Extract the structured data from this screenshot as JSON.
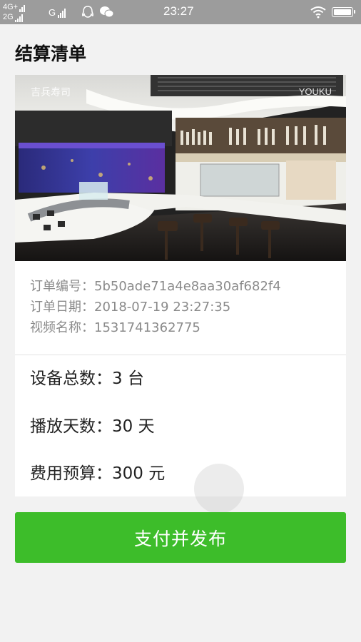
{
  "status_bar": {
    "network_top": "4G+",
    "network_bottom": "2G",
    "network_g": "G",
    "time": "23:27",
    "icons": [
      "signal-icon",
      "qq-icon",
      "wechat-icon",
      "wifi-icon",
      "battery-icon"
    ]
  },
  "page": {
    "title": "结算清单"
  },
  "video": {
    "logo_text": "吉兵寿司",
    "watermark_text": "YOUKU"
  },
  "order_info": {
    "order_no": "订单编号：5b50ade71a4e8aa30af682f4",
    "order_date": "订单日期：2018-07-19 23:27:35",
    "video_name": "视频名称：1531741362775"
  },
  "summary": {
    "device_count": "设备总数：3 台",
    "play_days": "播放天数：30 天",
    "budget": "费用预算：300 元"
  },
  "actions": {
    "pay_publish": "支付并发布"
  },
  "colors": {
    "status_bar": "#9c9c9c",
    "background": "#f2f2f2",
    "primary_button": "#3dbd2a"
  }
}
